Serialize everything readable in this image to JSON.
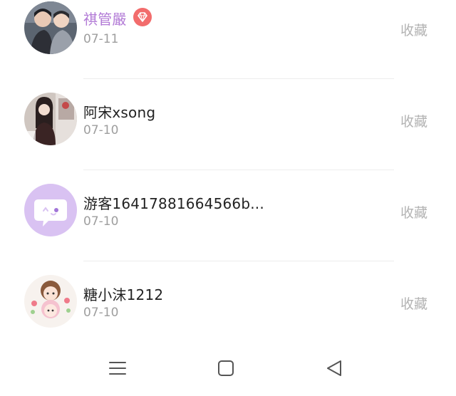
{
  "items": [
    {
      "name": "祺管嚴",
      "date": "07-11",
      "action": "收藏",
      "vip": true,
      "avatar": "photo-avatar-couple"
    },
    {
      "name": "阿宋xsong",
      "date": "07-10",
      "action": "收藏",
      "vip": false,
      "avatar": "photo-avatar-girl"
    },
    {
      "name": "游客16417881664566b...",
      "date": "07-10",
      "action": "收藏",
      "vip": false,
      "avatar": "chat-bubble-avatar"
    },
    {
      "name": "糖小沫1212",
      "date": "07-10",
      "action": "收藏",
      "vip": false,
      "avatar": "illustrated-avatar"
    }
  ],
  "colors": {
    "vip_name": "#b27ad6",
    "vip_badge": "#f26c6c",
    "avatar_placeholder_bg": "#d9c2f2"
  },
  "navbar": {
    "icons": [
      "menu-icon",
      "home-square-icon",
      "back-triangle-icon"
    ]
  }
}
